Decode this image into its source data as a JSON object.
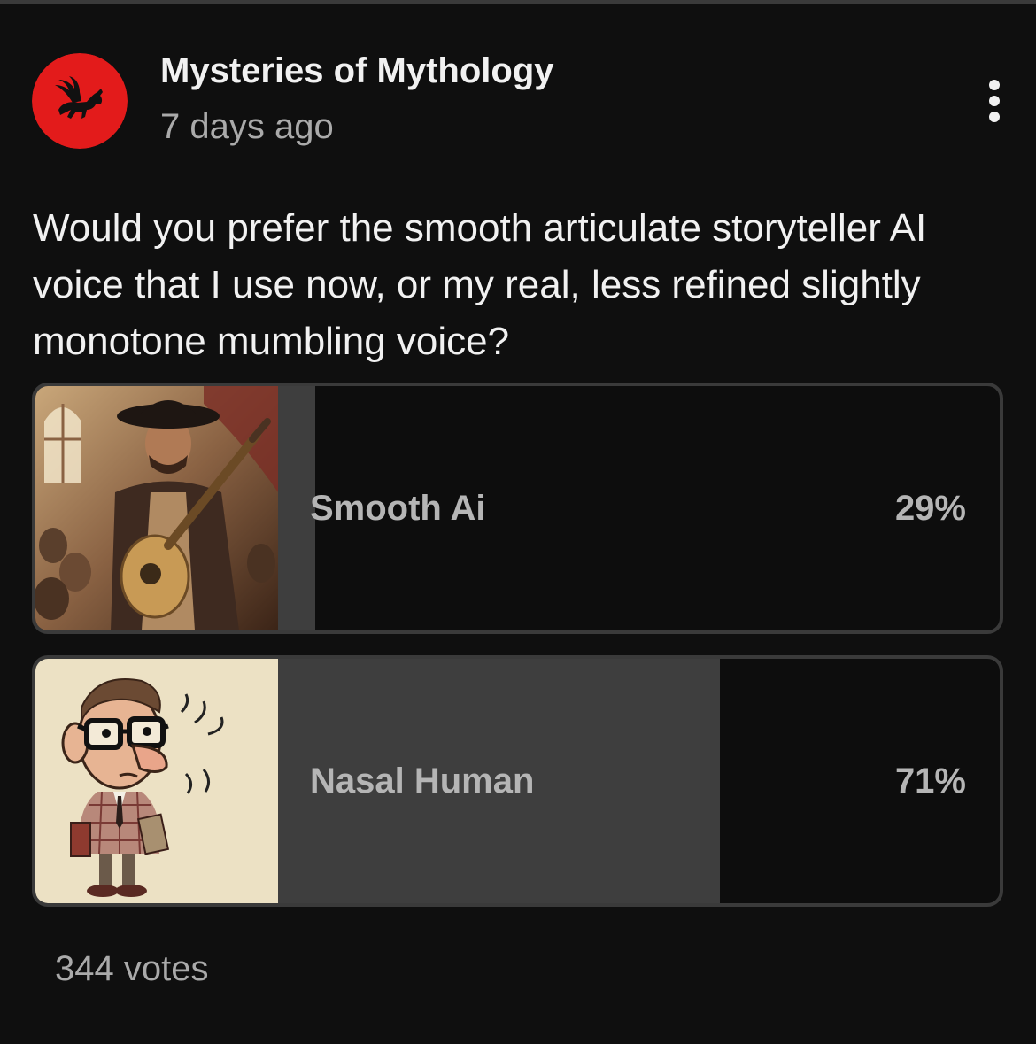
{
  "post": {
    "channel_name": "Mysteries of Mythology",
    "time_ago": "7 days ago",
    "avatar_icon": "pegasus-icon",
    "avatar_color": "#e31b1b",
    "more_icon": "more-vert-icon",
    "question": "Would you prefer the smooth articulate storyteller AI voice that I use now, or my real, less refined slightly monotone mumbling voice?"
  },
  "poll": {
    "options": [
      {
        "label": "Smooth Ai",
        "percent_text": "29%",
        "share": 0.29,
        "thumbnail": "lute-storyteller-image"
      },
      {
        "label": "Nasal Human",
        "percent_text": "71%",
        "share": 0.71,
        "thumbnail": "nasal-man-cartoon-image"
      }
    ],
    "votes": "344 votes",
    "fill_color": "#3e3e3e",
    "empty_color": "#0d0d0d",
    "border_color": "#3a3a3a"
  }
}
